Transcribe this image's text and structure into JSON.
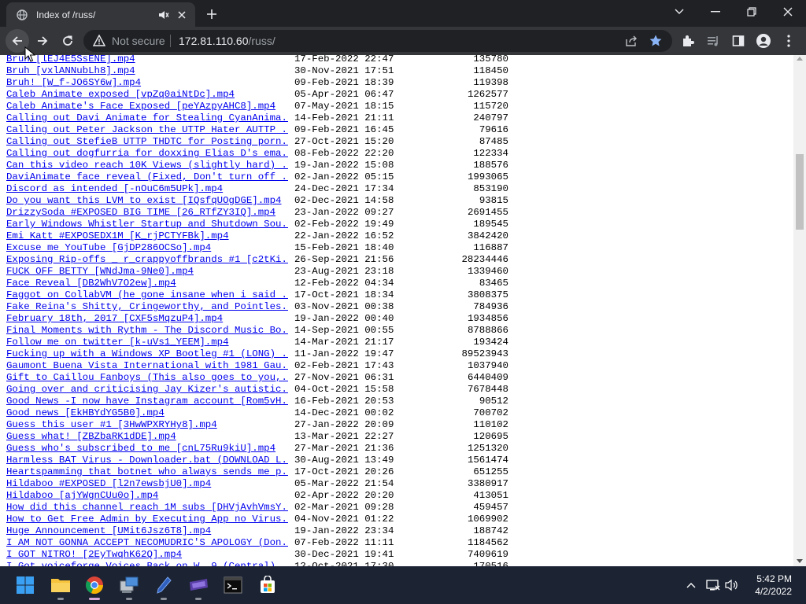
{
  "browser": {
    "tab_title": "Index of /russ/",
    "not_secure_label": "Not secure",
    "url_host": "172.81.110.60",
    "url_path": "/russ/"
  },
  "listing": [
    {
      "name": "Bruh [lEJ4E5SsENE].mp4",
      "date": "17-Feb-2022 22:47",
      "size": "135780"
    },
    {
      "name": "Bruh [vxlANNubLh8].mp4",
      "date": "30-Nov-2021 17:51",
      "size": "118450"
    },
    {
      "name": "Bruh! [W_f-JO6SY6w].mp4",
      "date": "09-Feb-2021 18:39",
      "size": "119398"
    },
    {
      "name": "Caleb Animate exposed [vpZq0aiNtDc].mp4",
      "date": "05-Apr-2021 06:47",
      "size": "1262577"
    },
    {
      "name": "Caleb Animate's Face Exposed [peYAzpyAHC8].mp4",
      "date": "07-May-2021 18:15",
      "size": "115720"
    },
    {
      "name": "Calling out Davi Animate for Stealing CyanAnima..>",
      "date": "14-Feb-2021 21:11",
      "size": "240797"
    },
    {
      "name": "Calling out Peter Jackson the UTTP Hater AUTTP ..>",
      "date": "09-Feb-2021 16:45",
      "size": "79616"
    },
    {
      "name": "Calling out StefieB UTTP THDTC for Posting porn..>",
      "date": "27-Oct-2021 15:20",
      "size": "87485"
    },
    {
      "name": "Calling out dogfurria for doxxing Elias D's ema..>",
      "date": "08-Feb-2022 22:20",
      "size": "122334"
    },
    {
      "name": "Can this video reach 10K Views (slightly hard) ..>",
      "date": "19-Jan-2022 15:08",
      "size": "188576"
    },
    {
      "name": "DaviAnimate face reveal (Fixed, Don't turn off ..>",
      "date": "02-Jan-2022 05:15",
      "size": "1993065"
    },
    {
      "name": "Discord as intended [-nOuC6m5UPk].mp4",
      "date": "24-Dec-2021 17:34",
      "size": "853190"
    },
    {
      "name": "Do you want this LVM to exist [IQsfqUOgDGE].mp4",
      "date": "02-Dec-2021 14:58",
      "size": "93815"
    },
    {
      "name": "DrizzySoda #EXPOSED BIG TIME [26_RTfZY3IQ].mp4",
      "date": "23-Jan-2022 09:27",
      "size": "2691455"
    },
    {
      "name": "Early Windows Whistler Startup and Shutdown Sou..>",
      "date": "02-Feb-2022 19:49",
      "size": "189545"
    },
    {
      "name": "Emi Katt #EXPOSEDX1M [K_rjPCTYFBk].mp4",
      "date": "22-Jan-2022 16:52",
      "size": "3842420"
    },
    {
      "name": "Excuse me YouTube [GjDP286OCSo].mp4",
      "date": "15-Feb-2021 18:40",
      "size": "116887"
    },
    {
      "name": "Exposing Rip-offs _ r_crappyoffbrands #1 [c2tKi..>",
      "date": "26-Sep-2021 21:56",
      "size": "28234446"
    },
    {
      "name": "FUCK OFF BETTY [WNdJma-9Ne0].mp4",
      "date": "23-Aug-2021 23:18",
      "size": "1339460"
    },
    {
      "name": "Face Reveal [DB2WhV7O2ew].mp4",
      "date": "12-Feb-2022 04:34",
      "size": "83465"
    },
    {
      "name": "Faggot on CollabVM (he gone insane when i said ..>",
      "date": "17-Oct-2021 18:34",
      "size": "3808375"
    },
    {
      "name": "Fake Reina's Shitty, Cringeworthy, and Pointles..>",
      "date": "03-Nov-2021 00:38",
      "size": "784936"
    },
    {
      "name": "February 18th, 2017 [CXF5sMqzuP4].mp4",
      "date": "19-Jan-2022 00:40",
      "size": "1934856"
    },
    {
      "name": "Final Moments with Rythm - The Discord Music Bo..>",
      "date": "14-Sep-2021 00:55",
      "size": "8788866"
    },
    {
      "name": "Follow me on twitter [k-uVs1_YEEM].mp4",
      "date": "14-Mar-2021 21:17",
      "size": "193424"
    },
    {
      "name": "Fucking up with a Windows XP Bootleg #1 (LONG) ..>",
      "date": "11-Jan-2022 19:47",
      "size": "89523943"
    },
    {
      "name": "Gaumont Buena Vista International with 1981 Gau..>",
      "date": "02-Feb-2021 17:43",
      "size": "1037940"
    },
    {
      "name": "Gift to Caillou Fanboys (This also goes to you,..>",
      "date": "27-Nov-2021 06:31",
      "size": "6440409"
    },
    {
      "name": "Going over and criticising Jay Kizer's autistic..>",
      "date": "04-Oct-2021 15:58",
      "size": "7678448"
    },
    {
      "name": "Good News -I now have Instagram account [Rom5vH..>",
      "date": "16-Feb-2021 20:53",
      "size": "90512"
    },
    {
      "name": "Good news [EkHBYdYG5B0].mp4",
      "date": "14-Dec-2021 00:02",
      "size": "700702"
    },
    {
      "name": "Guess this user #1 [3HwWPXRYHy8].mp4",
      "date": "27-Jan-2022 20:09",
      "size": "110102"
    },
    {
      "name": "Guess what! [ZBZbaRK1dDE].mp4",
      "date": "13-Mar-2021 22:27",
      "size": "120695"
    },
    {
      "name": "Guess who's subscribed to me [cnL75Ru9kiU].mp4",
      "date": "27-Mar-2021 21:36",
      "size": "1251320"
    },
    {
      "name": "Harmless BAT Virus - Downloader.bat (DOWNLOAD L..>",
      "date": "30-Aug-2021 13:49",
      "size": "1561474"
    },
    {
      "name": "Heartspamming that botnet who always sends me p..>",
      "date": "17-Oct-2021 20:26",
      "size": "651255"
    },
    {
      "name": "Hildaboo #EXPOSED [l2n7ewsbjU0].mp4",
      "date": "05-Mar-2022 21:54",
      "size": "3380917"
    },
    {
      "name": "Hildaboo [ajYWgnCUu0o].mp4",
      "date": "02-Apr-2022 20:20",
      "size": "413051"
    },
    {
      "name": "How did this channel reach 1M subs [DHVjAvhVmsY..>",
      "date": "02-Mar-2021 09:28",
      "size": "459457"
    },
    {
      "name": "How to Get Free Admin by Executing App no Virus..>",
      "date": "04-Nov-2021 01:22",
      "size": "1069902"
    },
    {
      "name": "Huge Announcement [UMit6Jsz6T8].mp4",
      "date": "19-Jan-2022 23:34",
      "size": "188742"
    },
    {
      "name": "I AM NOT GONNA ACCEPT NECOMUDRIC'S APOLOGY (Don..>",
      "date": "07-Feb-2022 11:11",
      "size": "1184562"
    },
    {
      "name": "I GOT NITRO! [2EyTwqhK62Q].mp4",
      "date": "30-Dec-2021 19:41",
      "size": "7409619"
    },
    {
      "name": "I Got voiceforge Voices Back on W..9 (Central) ..>",
      "date": "12-Oct-2021 17:30",
      "size": "170516"
    }
  ],
  "taskbar": {
    "time": "5:42 PM",
    "date": "4/2/2022"
  }
}
